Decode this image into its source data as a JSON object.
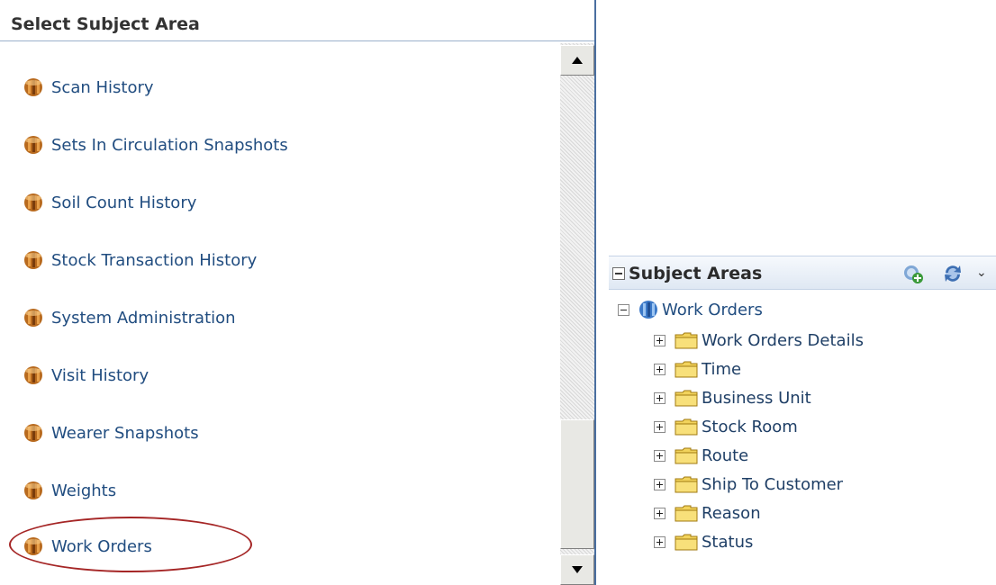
{
  "left_panel": {
    "title": "Select Subject Area",
    "items": [
      {
        "label": "Scan History"
      },
      {
        "label": "Sets In Circulation Snapshots"
      },
      {
        "label": "Soil Count History"
      },
      {
        "label": "Stock Transaction History"
      },
      {
        "label": "System Administration"
      },
      {
        "label": "Visit History"
      },
      {
        "label": "Wearer Snapshots"
      },
      {
        "label": "Weights"
      },
      {
        "label": "Work Orders"
      }
    ]
  },
  "right_panel": {
    "title": "Subject Areas",
    "root": {
      "label": "Work Orders"
    },
    "folders": [
      {
        "label": "Work Orders Details"
      },
      {
        "label": "Time"
      },
      {
        "label": "Business Unit"
      },
      {
        "label": "Stock Room"
      },
      {
        "label": "Route"
      },
      {
        "label": "Ship To Customer"
      },
      {
        "label": "Reason"
      },
      {
        "label": "Status"
      }
    ]
  },
  "colors": {
    "link": "#214d80",
    "highlight": "#a52626",
    "folder": "#f2d35c"
  }
}
